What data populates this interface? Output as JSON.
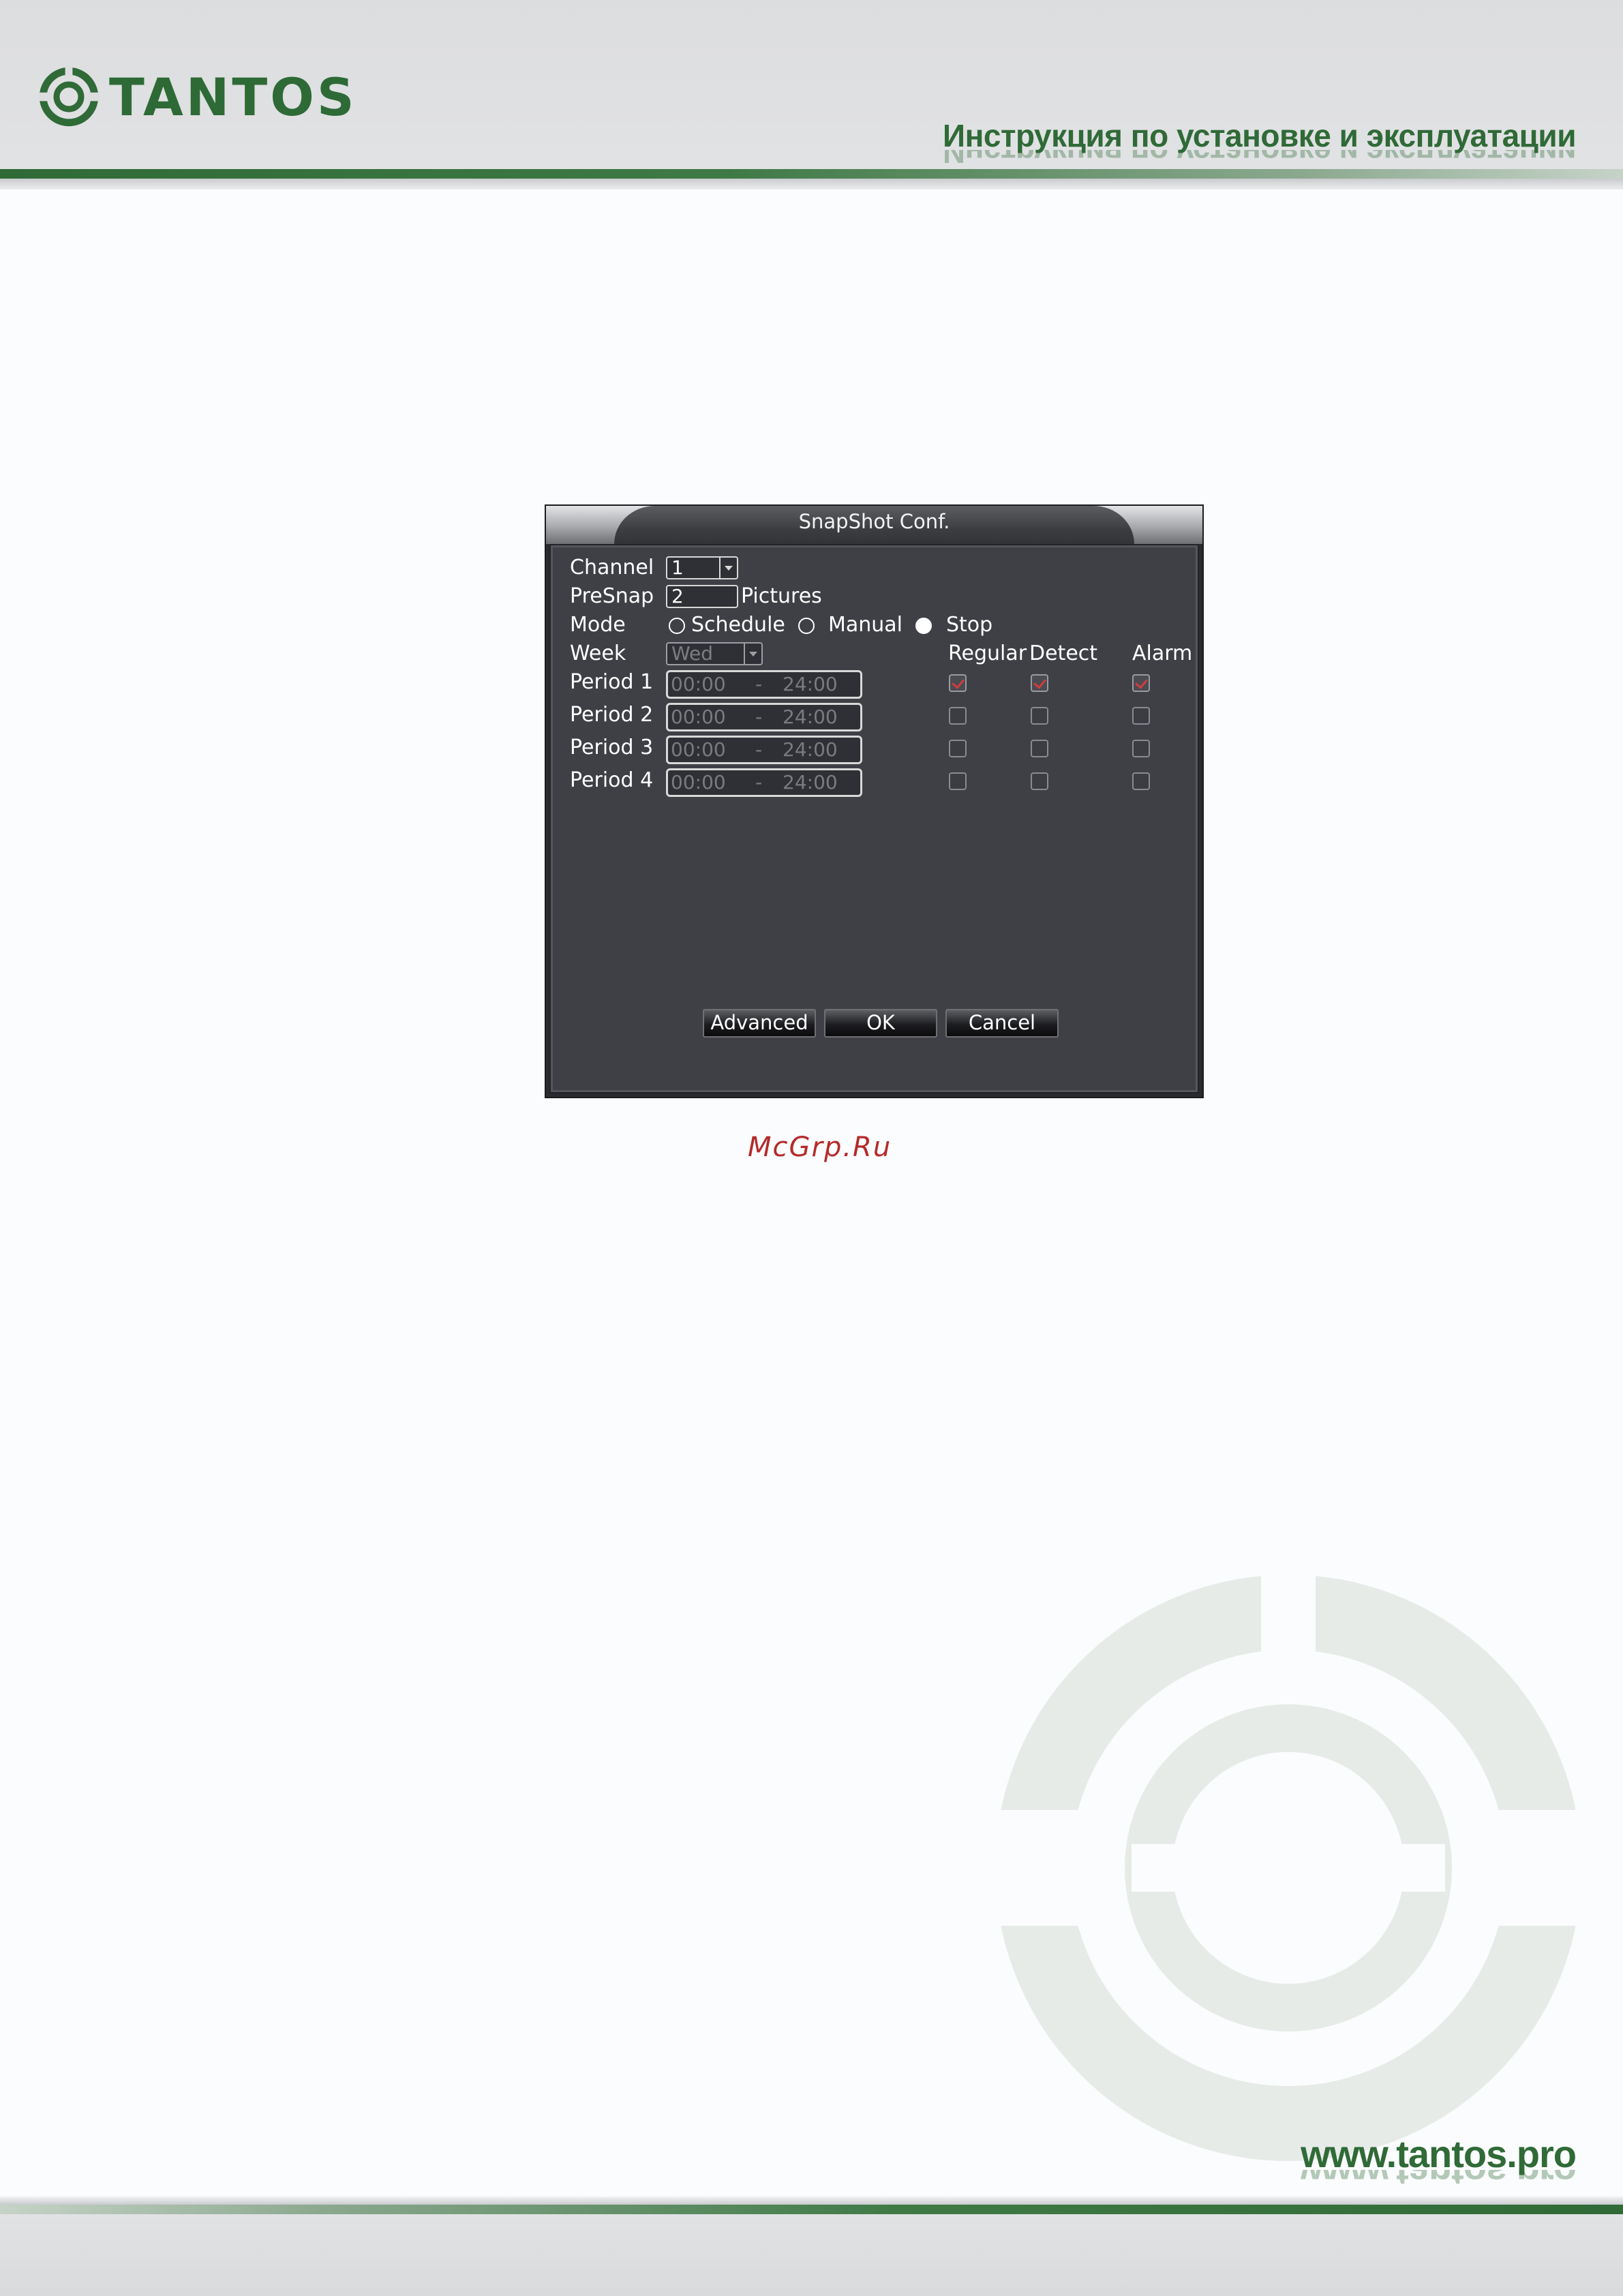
{
  "header": {
    "brand": "TANTOS",
    "manual_title": "Инструкция по установке и эксплуатации",
    "brand_color": "#2f6a37",
    "logo_icon": "tantos-logo-icon"
  },
  "dialog": {
    "title": "SnapShot Conf.",
    "channel": {
      "label": "Channel",
      "value": "1"
    },
    "presnap": {
      "label": "PreSnap",
      "value": "2",
      "unit": "Pictures"
    },
    "mode": {
      "label": "Mode",
      "options": [
        {
          "label": "Schedule",
          "checked": false
        },
        {
          "label": "Manual",
          "checked": false
        },
        {
          "label": "Stop",
          "checked": true
        }
      ]
    },
    "week": {
      "label": "Week",
      "value": "Wed"
    },
    "columns": {
      "regular": "Regular",
      "detect": "Detect",
      "alarm": "Alarm"
    },
    "periods": [
      {
        "label": "Period 1",
        "start": "00:00",
        "sep": "-",
        "end": "24:00",
        "regular": true,
        "detect": true,
        "alarm": true
      },
      {
        "label": "Period 2",
        "start": "00:00",
        "sep": "-",
        "end": "24:00",
        "regular": false,
        "detect": false,
        "alarm": false
      },
      {
        "label": "Period 3",
        "start": "00:00",
        "sep": "-",
        "end": "24:00",
        "regular": false,
        "detect": false,
        "alarm": false
      },
      {
        "label": "Period 4",
        "start": "00:00",
        "sep": "-",
        "end": "24:00",
        "regular": false,
        "detect": false,
        "alarm": false
      }
    ],
    "buttons": {
      "advanced": "Advanced",
      "ok": "OK",
      "cancel": "Cancel"
    },
    "check_color": "#d23c3c"
  },
  "watermark": {
    "site": "McGrp.Ru",
    "color": "#b52a2a"
  },
  "footer": {
    "url": "www.tantos.pro"
  }
}
